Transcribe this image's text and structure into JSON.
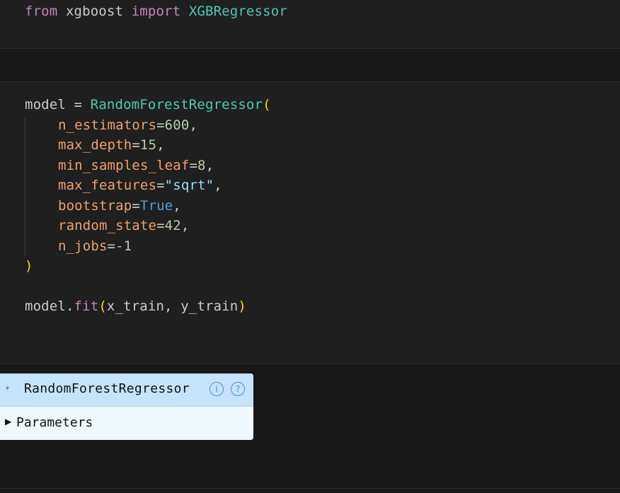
{
  "cells": {
    "import_cell": {
      "kw_from": "from",
      "module": "xgboost",
      "kw_import": "import",
      "cls": "XGBRegressor"
    },
    "model_cell": {
      "line1": {
        "var": "model",
        "eq": " = ",
        "cls": "RandomForestRegressor",
        "open": "("
      },
      "params": [
        {
          "name": "n_estimators",
          "eq": "=",
          "value": "600",
          "type": "num",
          "comma": ","
        },
        {
          "name": "max_depth",
          "eq": "=",
          "value": "15",
          "type": "num",
          "comma": ","
        },
        {
          "name": "min_samples_leaf",
          "eq": "=",
          "value": "8",
          "type": "num",
          "comma": ","
        },
        {
          "name": "max_features",
          "eq": "=",
          "value": "\"sqrt\"",
          "type": "str",
          "comma": ","
        },
        {
          "name": "bootstrap",
          "eq": "=",
          "value": "True",
          "type": "const",
          "comma": ","
        },
        {
          "name": "random_state",
          "eq": "=",
          "value": "42",
          "type": "num",
          "comma": ","
        },
        {
          "name": "n_jobs",
          "eq": "=",
          "value": "-1",
          "type": "num",
          "comma": ""
        }
      ],
      "close": ")",
      "fit": {
        "obj": "model",
        "dot": ".",
        "method": "fit",
        "open": "(",
        "args": "x_train, y_train",
        "close": ")"
      }
    }
  },
  "output_widget": {
    "caret": "▾",
    "estimator_name": "RandomForestRegressor",
    "info_icon": "i",
    "help_icon": "?",
    "params_arrow": "▶",
    "params_label": "Parameters"
  }
}
